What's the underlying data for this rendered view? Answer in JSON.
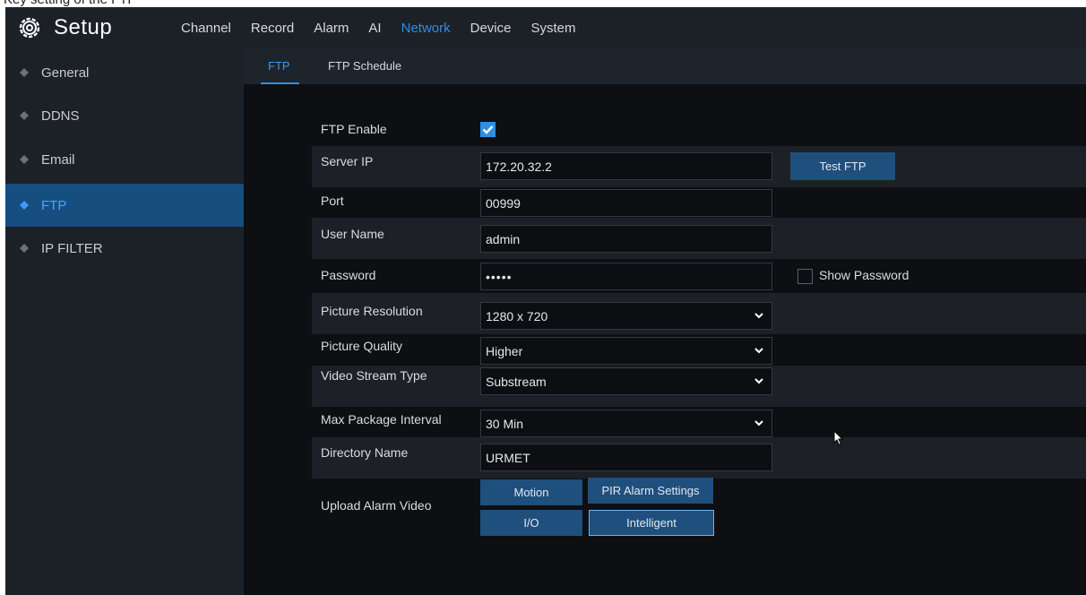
{
  "top_strip_text": "Key setting of the FTP",
  "header": {
    "title": "Setup",
    "menu": [
      "Channel",
      "Record",
      "Alarm",
      "AI",
      "Network",
      "Device",
      "System"
    ],
    "active_menu": "Network"
  },
  "sidebar": {
    "items": [
      {
        "label": "General"
      },
      {
        "label": "DDNS"
      },
      {
        "label": "Email"
      },
      {
        "label": "FTP",
        "active": true
      },
      {
        "label": "IP FILTER"
      }
    ]
  },
  "subtabs": [
    "FTP",
    "FTP Schedule"
  ],
  "form": {
    "ftp_enable_label": "FTP Enable",
    "ftp_enabled": true,
    "server_ip_label": "Server IP",
    "server_ip_value": "172.20.32.2",
    "test_ftp_label": "Test FTP",
    "port_label": "Port",
    "port_value": "00999",
    "user_name_label": "User Name",
    "user_name_value": "admin",
    "password_label": "Password",
    "password_value": "•••••",
    "show_password_label": "Show Password",
    "show_password_checked": false,
    "picture_resolution_label": "Picture Resolution",
    "picture_resolution_value": "1280 x 720",
    "picture_quality_label": "Picture Quality",
    "picture_quality_value": "Higher",
    "video_stream_type_label": "Video Stream Type",
    "video_stream_type_value": "Substream",
    "max_package_interval_label": "Max Package Interval",
    "max_package_interval_value": "30 Min",
    "directory_name_label": "Directory Name",
    "directory_name_value": "URMET",
    "upload_alarm_video_label": "Upload Alarm Video",
    "alarm_buttons": {
      "motion": "Motion",
      "pir": "PIR Alarm Settings",
      "io": "I/O",
      "intelligent": "Intelligent"
    }
  },
  "colors": {
    "accent": "#2f8fe0",
    "active_sidebar_bg": "#164e80",
    "button_bg": "#1f4f7d",
    "panel_bg": "#1c2128",
    "content_bg": "#0d0f12"
  }
}
